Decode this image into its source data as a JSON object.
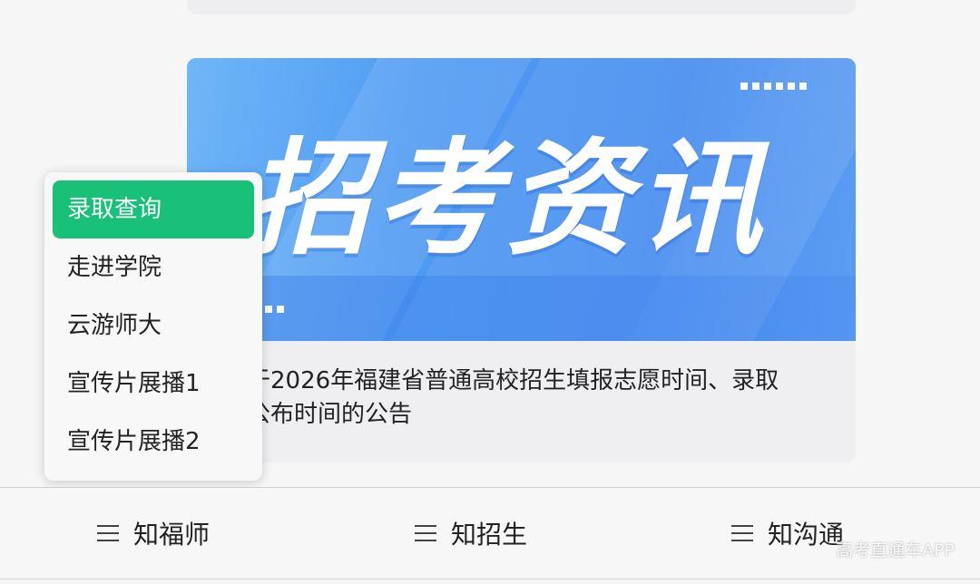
{
  "banner": {
    "title": "招考资讯"
  },
  "news": {
    "title_line1": "于2026年福建省普通高校招生填报志愿时间、录取",
    "title_line2": "公布时间的公告"
  },
  "popup_menu": {
    "items": [
      {
        "label": "录取查询",
        "active": true
      },
      {
        "label": "走进学院",
        "active": false
      },
      {
        "label": "云游师大",
        "active": false
      },
      {
        "label": "宣传片展播1",
        "active": false
      },
      {
        "label": "宣传片展播2",
        "active": false
      }
    ]
  },
  "bottom_nav": {
    "items": [
      {
        "label": "知福师",
        "icon": "menu-icon"
      },
      {
        "label": "知招生",
        "icon": "menu-icon"
      },
      {
        "label": "知沟通",
        "icon": "menu-icon"
      }
    ]
  },
  "watermark": "高考直通车APP",
  "colors": {
    "active_green": "#18c177",
    "banner_blue": "#4f9af2"
  }
}
